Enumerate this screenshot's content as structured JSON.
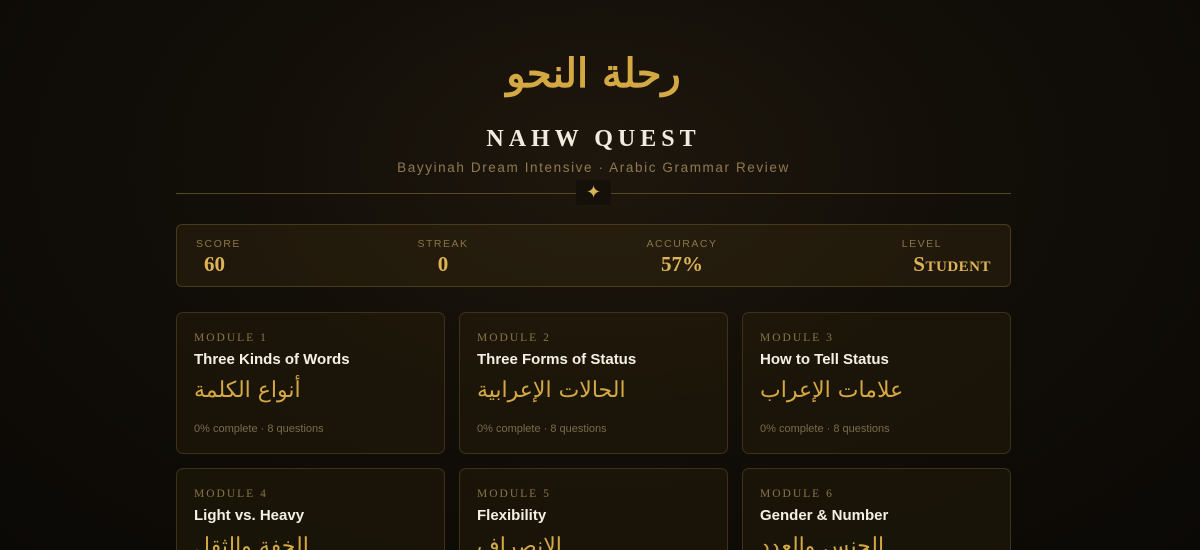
{
  "header": {
    "arabic_title": "رحلة النحو",
    "title": "NAHW QUEST",
    "subtitle": "Bayyinah Dream Intensive · Arabic Grammar Review",
    "divider_glyph": "✦"
  },
  "stats": {
    "score": {
      "label": "SCORE",
      "value": "60"
    },
    "streak": {
      "label": "STREAK",
      "value": "0"
    },
    "accuracy": {
      "label": "ACCURACY",
      "value": "57%"
    },
    "level": {
      "label": "LEVEL",
      "value": "Student"
    }
  },
  "modules": [
    {
      "module_label": "MODULE 1",
      "title": "Three Kinds of Words",
      "arabic": "أنواع الكلمة",
      "meta": "0% complete · 8 questions"
    },
    {
      "module_label": "MODULE 2",
      "title": "Three Forms of Status",
      "arabic": "الحالات الإعرابية",
      "meta": "0% complete · 8 questions"
    },
    {
      "module_label": "MODULE 3",
      "title": "How to Tell Status",
      "arabic": "علامات الإعراب",
      "meta": "0% complete · 8 questions"
    },
    {
      "module_label": "MODULE 4",
      "title": "Light vs. Heavy",
      "arabic": "الخفة والثقل",
      "meta": ""
    },
    {
      "module_label": "MODULE 5",
      "title": "Flexibility",
      "arabic": "الانصراف",
      "meta": ""
    },
    {
      "module_label": "MODULE 6",
      "title": "Gender & Number",
      "arabic": "الجنس والعدد",
      "meta": ""
    }
  ],
  "colors": {
    "accent_gold": "#d4a843",
    "background": "#120e08",
    "card_border": "#3f3117"
  }
}
